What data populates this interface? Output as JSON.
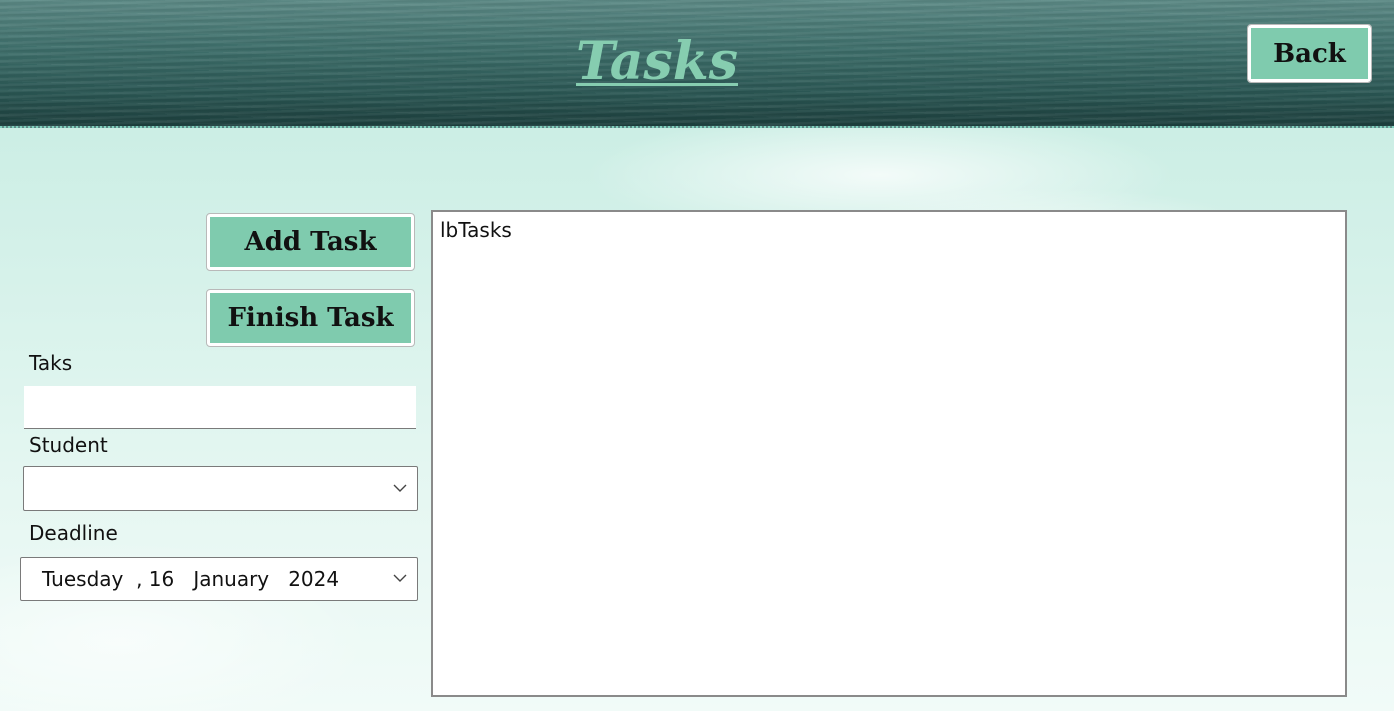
{
  "header": {
    "title": "Tasks",
    "back_label": "Back"
  },
  "actions": {
    "add_task_label": "Add Task",
    "finish_task_label": "Finish Task"
  },
  "form": {
    "task_label": "Taks",
    "task_value": "",
    "student_label": "Student",
    "student_selected": "",
    "deadline_label": "Deadline",
    "deadline_value": "Tuesday  , 16   January   2024"
  },
  "task_list": {
    "placeholder_text": "lbTasks"
  },
  "colors": {
    "accent": "#7fcbae",
    "title": "#86cdb0",
    "header_dark": "#2a5653",
    "background": "#d4f1e9"
  },
  "icons": {
    "dropdown": "chevron-down-icon"
  }
}
